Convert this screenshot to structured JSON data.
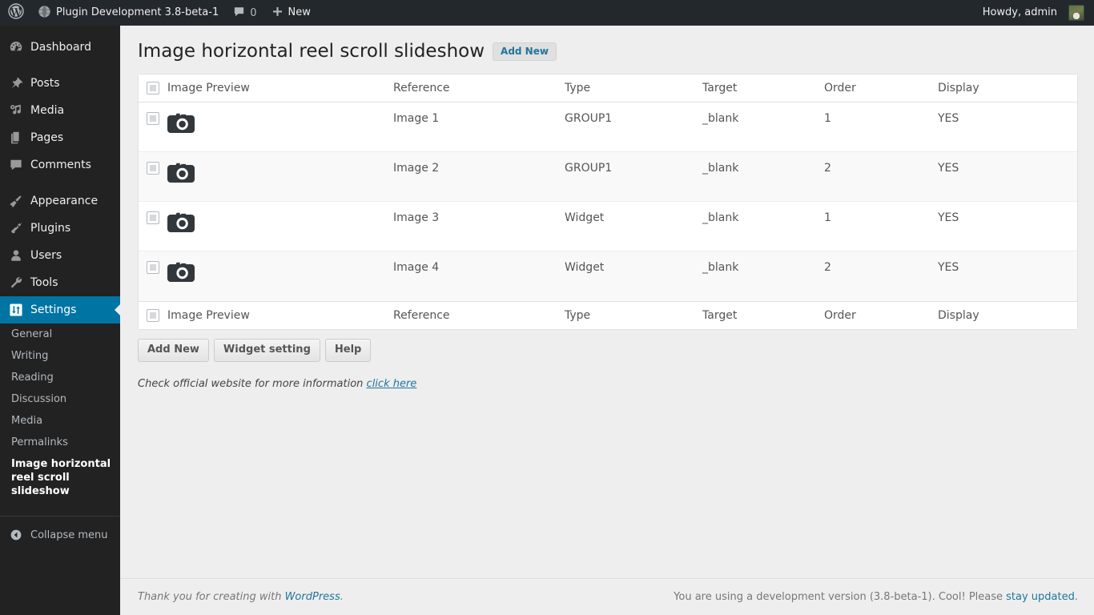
{
  "adminbar": {
    "wp_logo_icon": "wordpress-logo-icon",
    "site_icon": "globe-icon",
    "site_name": "Plugin Development 3.8-beta-1",
    "comments_icon": "comment-bubble-icon",
    "comments_count": "0",
    "new_icon": "plus-icon",
    "new_label": "New",
    "howdy": "Howdy, admin",
    "avatar": "avatar-image"
  },
  "sidebar": {
    "items": [
      {
        "label": "Dashboard",
        "icon": "dashboard-icon",
        "current": false
      },
      {
        "label": "Posts",
        "icon": "pin-icon",
        "current": false
      },
      {
        "label": "Media",
        "icon": "media-icon",
        "current": false
      },
      {
        "label": "Pages",
        "icon": "pages-icon",
        "current": false
      },
      {
        "label": "Comments",
        "icon": "comment-bubble-icon",
        "current": false
      },
      {
        "label": "Appearance",
        "icon": "paintbrush-icon",
        "current": false
      },
      {
        "label": "Plugins",
        "icon": "plug-icon",
        "current": false
      },
      {
        "label": "Users",
        "icon": "user-icon",
        "current": false
      },
      {
        "label": "Tools",
        "icon": "wrench-icon",
        "current": false
      },
      {
        "label": "Settings",
        "icon": "settings-sliders-icon",
        "current": true
      }
    ],
    "submenu": [
      {
        "label": "General",
        "current": false
      },
      {
        "label": "Writing",
        "current": false
      },
      {
        "label": "Reading",
        "current": false
      },
      {
        "label": "Discussion",
        "current": false
      },
      {
        "label": "Media",
        "current": false
      },
      {
        "label": "Permalinks",
        "current": false
      },
      {
        "label": "Image horizontal reel scroll slideshow",
        "current": true
      }
    ],
    "collapse": {
      "label": "Collapse menu",
      "icon": "collapse-arrow-icon"
    },
    "accent_color": "#0074a2",
    "background_color": "#222222"
  },
  "page": {
    "title": "Image horizontal reel scroll slideshow",
    "add_new_label": "Add New"
  },
  "table": {
    "columns": [
      "Image Preview",
      "Reference",
      "Type",
      "Target",
      "Order",
      "Display"
    ],
    "preview_icon": "camera-icon",
    "rows": [
      {
        "preview": "camera-icon",
        "reference": "Image 1",
        "type": "GROUP1",
        "target": "_blank",
        "order": "1",
        "display": "YES"
      },
      {
        "preview": "camera-icon",
        "reference": "Image 2",
        "type": "GROUP1",
        "target": "_blank",
        "order": "2",
        "display": "YES"
      },
      {
        "preview": "camera-icon",
        "reference": "Image 3",
        "type": "Widget",
        "target": "_blank",
        "order": "1",
        "display": "YES"
      },
      {
        "preview": "camera-icon",
        "reference": "Image 4",
        "type": "Widget",
        "target": "_blank",
        "order": "2",
        "display": "YES"
      }
    ]
  },
  "buttons": {
    "add_new": "Add New",
    "widget_setting": "Widget setting",
    "help": "Help"
  },
  "info": {
    "text": "Check official website for more information",
    "link_text": "click here"
  },
  "footer": {
    "left_text": "Thank you for creating with ",
    "left_link": "WordPress",
    "left_period": ".",
    "right_text": "You are using a development version (3.8-beta-1). Cool! Please ",
    "right_link": "stay updated",
    "right_period": "."
  }
}
